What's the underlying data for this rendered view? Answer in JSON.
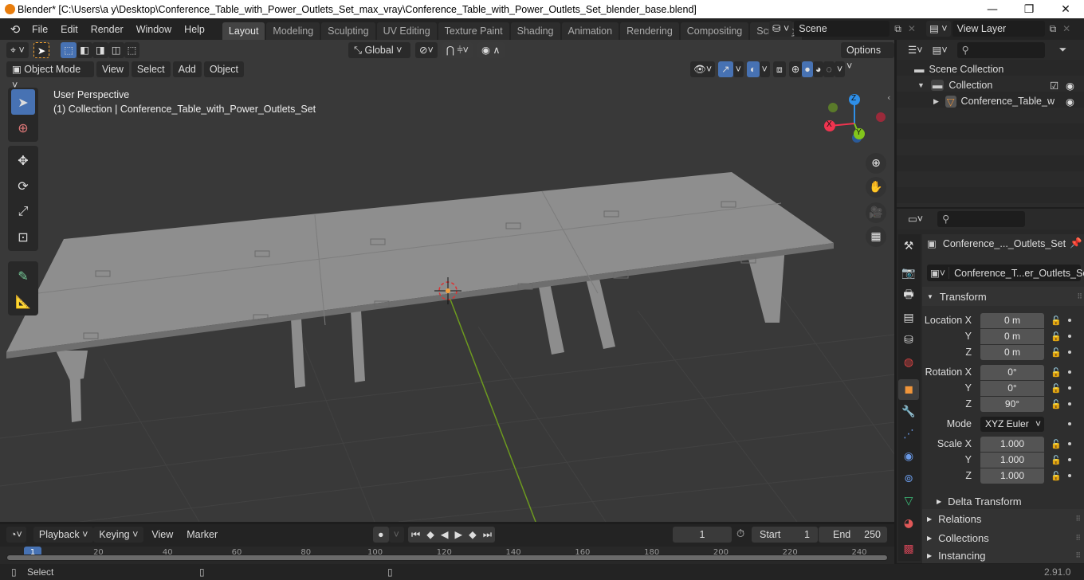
{
  "window": {
    "title": "Blender* [C:\\Users\\a y\\Desktop\\Conference_Table_with_Power_Outlets_Set_max_vray\\Conference_Table_with_Power_Outlets_Set_blender_base.blend]",
    "minimize": "—",
    "maximize": "❐",
    "close": "✕"
  },
  "menubar": {
    "items": [
      "File",
      "Edit",
      "Render",
      "Window",
      "Help"
    ]
  },
  "workspaces": [
    {
      "label": "Layout",
      "active": true
    },
    {
      "label": "Modeling"
    },
    {
      "label": "Sculpting"
    },
    {
      "label": "UV Editing"
    },
    {
      "label": "Texture Paint"
    },
    {
      "label": "Shading"
    },
    {
      "label": "Animation"
    },
    {
      "label": "Rendering"
    },
    {
      "label": "Compositing"
    },
    {
      "label": "Scripting"
    }
  ],
  "add_workspace": "+",
  "scene": {
    "name": "Scene"
  },
  "view_layer": {
    "name": "View Layer"
  },
  "viewport": {
    "transform_orientation": "Global",
    "options_label": "Options",
    "mode": "Object Mode",
    "menus": [
      "View",
      "Select",
      "Add",
      "Object"
    ],
    "overlay_title": "User Perspective",
    "overlay_subtitle": "(1) Collection | Conference_Table_with_Power_Outlets_Set",
    "gizmo": {
      "x": "X",
      "y": "Y",
      "z": "Z",
      "x_color": "#f0344f",
      "y_color": "#82c51c",
      "z_color": "#2e8fe8"
    }
  },
  "outliner": {
    "items": [
      {
        "label": "Scene Collection"
      },
      {
        "label": "Collection"
      },
      {
        "label": "Conference_Table_w"
      }
    ]
  },
  "properties": {
    "object_name": "Conference_..._Outlets_Set",
    "data_name": "Conference_T...er_Outlets_Set",
    "transform_label": "Transform",
    "location": {
      "label": "Location X",
      "x": "0 m",
      "y": "0 m",
      "z": "0 m"
    },
    "rotation": {
      "label": "Rotation X",
      "x": "0°",
      "y": "0°",
      "z": "90°"
    },
    "mode": {
      "label": "Mode",
      "value": "XYZ Euler"
    },
    "scale": {
      "label": "Scale X",
      "x": "1.000",
      "y": "1.000",
      "z": "1.000"
    },
    "axis_y": "Y",
    "axis_z": "Z",
    "delta_transform": "Delta Transform",
    "panels": [
      "Relations",
      "Collections",
      "Instancing"
    ]
  },
  "timeline": {
    "menus": [
      "Playback",
      "Keying",
      "View",
      "Marker"
    ],
    "current_frame": "1",
    "start_label": "Start",
    "start": "1",
    "end_label": "End",
    "end": "250",
    "ticks": [
      "1",
      "20",
      "40",
      "60",
      "80",
      "100",
      "120",
      "140",
      "160",
      "180",
      "200",
      "220",
      "240"
    ]
  },
  "statusbar": {
    "select": "Select",
    "version": "2.91.0"
  }
}
